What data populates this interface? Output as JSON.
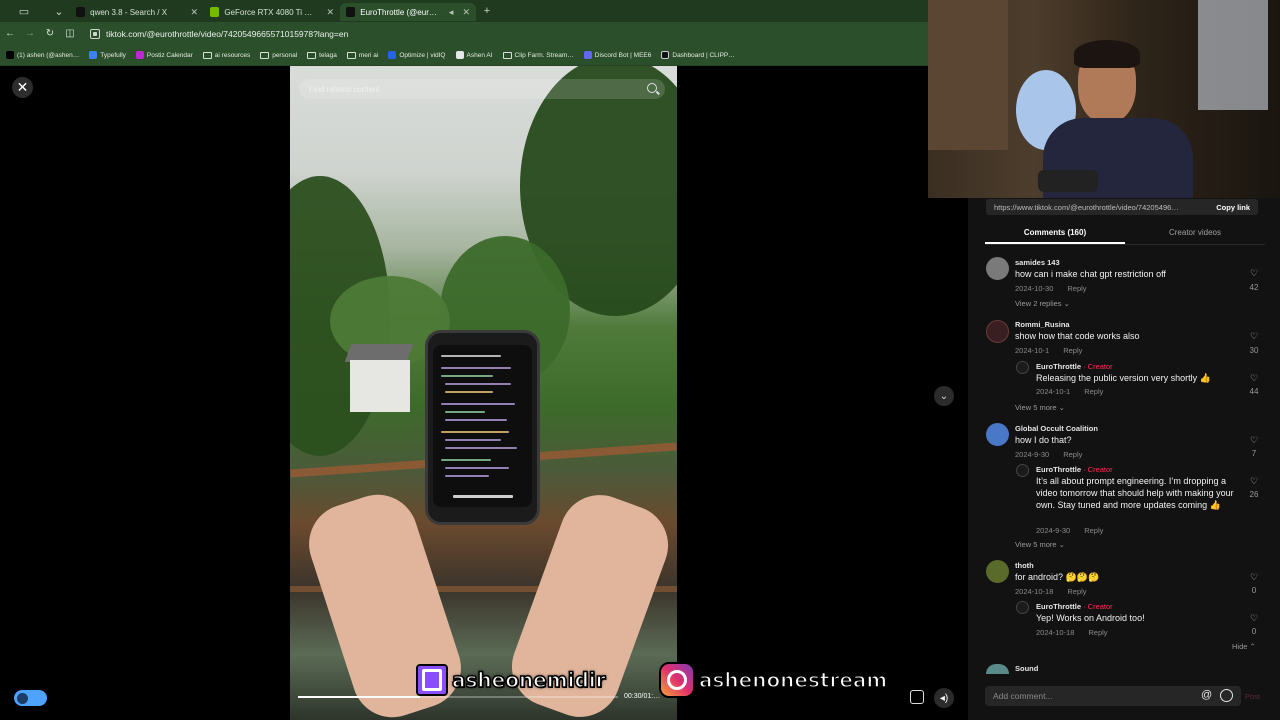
{
  "browser": {
    "tabs": [
      {
        "label": "qwen 3.8 - Search / X",
        "favicon_color": "#111111",
        "active": false
      },
      {
        "label": "GeForce RTX 4080 Ti & 406…",
        "favicon_color": "#76b900",
        "active": false
      },
      {
        "label": "EuroThrottle (@eurothrottl…",
        "favicon_color": "#111111",
        "active": true
      }
    ],
    "new_tab_symbol": "+",
    "url": "tiktok.com/@eurothrottle/video/7420549665571015978?lang=en",
    "bookmarks": [
      {
        "label": "(1) ashen (@ashen…",
        "type": "x"
      },
      {
        "label": "Typefully",
        "type": "site"
      },
      {
        "label": "Postiz Calendar",
        "type": "site"
      },
      {
        "label": "ai resources",
        "type": "folder"
      },
      {
        "label": "personal",
        "type": "folder"
      },
      {
        "label": "telaga",
        "type": "folder"
      },
      {
        "label": "meri ai",
        "type": "folder"
      },
      {
        "label": "Optimize | vidIQ",
        "type": "site"
      },
      {
        "label": "Ashen AI",
        "type": "site"
      },
      {
        "label": "Clip Farm. Stream…",
        "type": "folder"
      },
      {
        "label": "Discord Bot | MEE6",
        "type": "site"
      },
      {
        "label": "Dashboard | CLIPP…",
        "type": "site"
      }
    ]
  },
  "video": {
    "search_placeholder": "Find related content",
    "time": "00:30/01:…",
    "progress": 0.38
  },
  "overlays": {
    "twitch_handle": "asheonemidir",
    "instagram_handle": "ashenonestream"
  },
  "panel": {
    "share_url": "https://www.tiktok.com/@eurothrottle/video/74205496…",
    "copy_link": "Copy link",
    "tabs": [
      "Comments (160)",
      "Creator videos"
    ],
    "comments": [
      {
        "user": "samides 143",
        "text": "how can i make chat gpt restriction off",
        "date": "2024-10-30",
        "reply": "Reply",
        "likes": "42",
        "more": "View 2 replies ⌄",
        "avatar": "#7a7a7a"
      },
      {
        "user": "Rommi_Rusina",
        "text": "show how that code works also",
        "date": "2024-10-1",
        "reply": "Reply",
        "likes": "30",
        "avatar": "#3a1f22"
      },
      {
        "user": "EuroThrottle",
        "creator": " · Creator",
        "text": "Releasing the public version very shortly 👍",
        "date": "2024-10-1",
        "reply": "Reply",
        "likes": "44",
        "more": "View 5 more ⌄",
        "avatar": "#1b1b1b"
      },
      {
        "user": "Global Occult Coalition",
        "text": "how I do that?",
        "date": "2024-9-30",
        "reply": "Reply",
        "likes": "7",
        "avatar": "#4a78c8"
      },
      {
        "user": "EuroThrottle",
        "creator": " · Creator",
        "text": "It’s all about prompt engineering. I’m dropping a video tomorrow that should help with making your own. Stay tuned and more updates coming 👍",
        "date": "2024-9-30",
        "reply": "Reply",
        "likes": "26",
        "more": "View 5 more ⌄",
        "avatar": "#1b1b1b"
      },
      {
        "user": "thoth",
        "text": "for android? 🤔🤔🤔",
        "date": "2024-10-18",
        "reply": "Reply",
        "likes": "0",
        "avatar": "#5a6a2a"
      },
      {
        "user": "EuroThrottle",
        "creator": " · Creator",
        "text": "Yep! Works on Android too!",
        "date": "2024-10-18",
        "reply": "Reply",
        "likes": "0",
        "avatar": "#1b1b1b"
      }
    ],
    "hide": "Hide ⌃",
    "next_user": "Sound",
    "add_comment_placeholder": "Add comment...",
    "post": "Post"
  }
}
